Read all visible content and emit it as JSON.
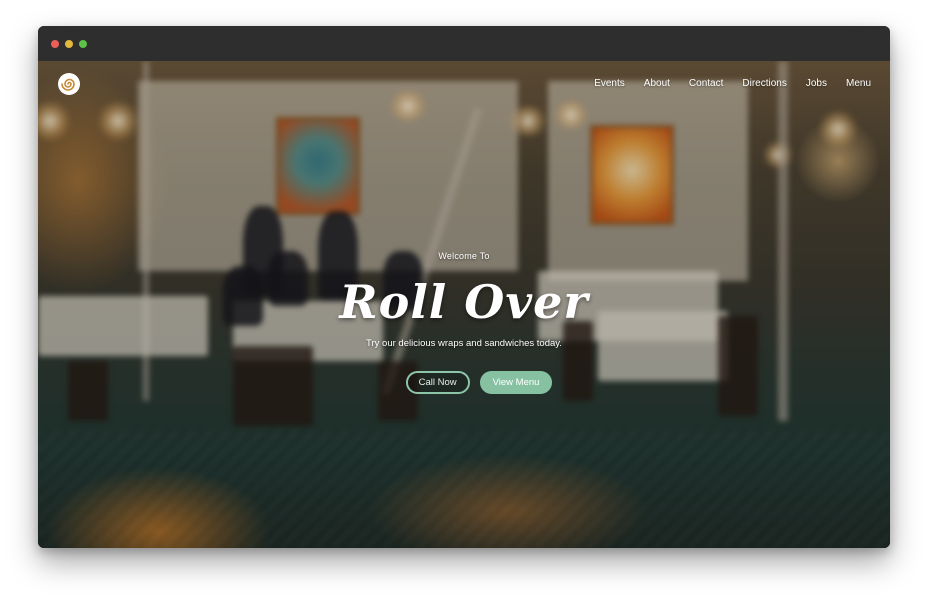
{
  "window": {
    "controls": [
      "close",
      "minimize",
      "maximize"
    ]
  },
  "logo": {
    "icon": "spiral-logo-icon"
  },
  "nav": {
    "items": [
      {
        "label": "Events"
      },
      {
        "label": "About"
      },
      {
        "label": "Contact"
      },
      {
        "label": "Directions"
      },
      {
        "label": "Jobs"
      },
      {
        "label": "Menu"
      }
    ]
  },
  "hero": {
    "welcome": "Welcome To",
    "title": "Roll Over",
    "tagline": "Try our delicious wraps and sandwiches today.",
    "buttons": {
      "call": "Call Now",
      "menu": "View Menu"
    }
  },
  "colors": {
    "accent": "#86c2a2",
    "titlebar": "#2e2e2e",
    "close": "#ec5f57",
    "minimize": "#e2b93b",
    "maximize": "#5cc348"
  }
}
